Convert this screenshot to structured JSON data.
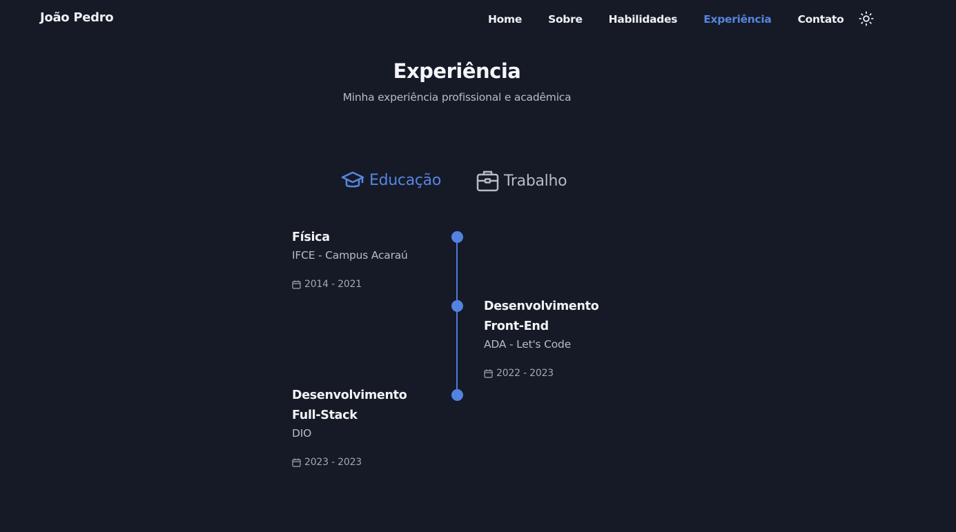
{
  "header": {
    "brand": "João Pedro",
    "nav": [
      "Home",
      "Sobre",
      "Habilidades",
      "Experiência",
      "Contato"
    ],
    "active": "Experiência",
    "theme_icon": "sun-icon"
  },
  "section": {
    "title": "Experiência",
    "subtitle": "Minha experiência profissional e acadêmica"
  },
  "tabs": [
    {
      "label": "Educação",
      "icon": "graduation-cap-icon",
      "active": true
    },
    {
      "label": "Trabalho",
      "icon": "briefcase-icon",
      "active": false
    }
  ],
  "timeline": [
    {
      "title": "Física",
      "org": "IFCE - Campus Acaraú",
      "dates": "2014 - 2021",
      "side": "left"
    },
    {
      "title": "Desenvolvimento Front-End",
      "org": "ADA - Let's Code",
      "dates": "2022 - 2023",
      "side": "right"
    },
    {
      "title": "Desenvolvimento Full-Stack",
      "org": "DIO",
      "dates": "2023 - 2023",
      "side": "left"
    }
  ],
  "colors": {
    "background": "#151a26",
    "accent": "#5785e0",
    "text": "#f1f3f6",
    "muted": "#b8bcc6"
  }
}
